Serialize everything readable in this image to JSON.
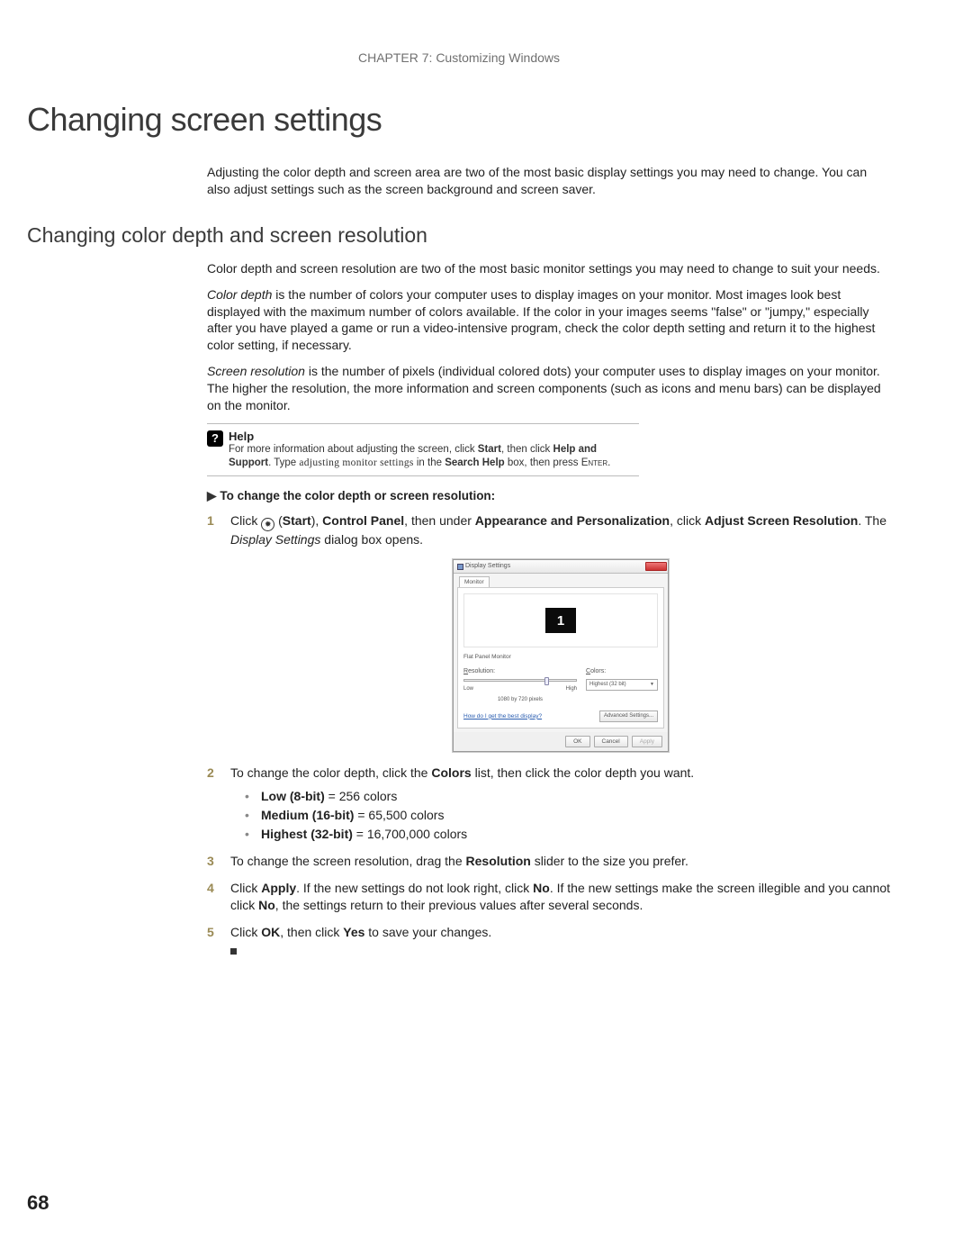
{
  "header": {
    "chapter": "CHAPTER 7: Customizing Windows"
  },
  "title": "Changing screen settings",
  "intro": "Adjusting the color depth and screen area are two of the most basic display settings you may need to change. You can also adjust settings such as the screen background and screen saver.",
  "subtitle": "Changing color depth and screen resolution",
  "para1": "Color depth and screen resolution are two of the most basic monitor settings you may need to change to suit your needs.",
  "para2_lead": "Color depth",
  "para2_rest": " is the number of colors your computer uses to display images on your monitor. Most images look best displayed with the maximum number of colors available. If the color in your images seems \"false\" or \"jumpy,\" especially after you have played a game or run a video-intensive program, check the color depth setting and return it to the highest color setting, if necessary.",
  "para3_lead": "Screen resolution",
  "para3_rest": " is the number of pixels (individual colored dots) your computer uses to display images on your monitor. The higher the resolution, the more information and screen components (such as icons and menu bars) can be displayed on the monitor.",
  "help": {
    "title": "Help",
    "line1_a": "For more information about adjusting the screen, click ",
    "line1_b": "Start",
    "line1_c": ", then click ",
    "line1_d": "Help and Support",
    "line1_e": ". Type ",
    "line1_f": "adjusting monitor settings",
    "line1_g": " in the ",
    "line1_h": "Search Help",
    "line1_i": " box, then press ",
    "line1_j": "Enter",
    "line1_k": "."
  },
  "procedure_title": "To change the color depth or screen resolution:",
  "steps": {
    "s1_a": "Click ",
    "s1_b": " (",
    "s1_c": "Start",
    "s1_d": "), ",
    "s1_e": "Control Panel",
    "s1_f": ", then under ",
    "s1_g": "Appearance and Personalization",
    "s1_h": ", click ",
    "s1_i": "Adjust Screen Resolution",
    "s1_j": ". The ",
    "s1_k": "Display Settings",
    "s1_l": " dialog box opens.",
    "s2_a": "To change the color depth, click the ",
    "s2_b": "Colors",
    "s2_c": " list, then click the color depth you want.",
    "bullets": {
      "b1_a": "Low (8-bit)",
      "b1_b": " = 256 colors",
      "b2_a": "Medium (16-bit)",
      "b2_b": " = 65,500 colors",
      "b3_a": "Highest (32-bit)",
      "b3_b": " = 16,700,000 colors"
    },
    "s3_a": "To change the screen resolution, drag the ",
    "s3_b": "Resolution",
    "s3_c": " slider to the size you prefer.",
    "s4_a": "Click ",
    "s4_b": "Apply",
    "s4_c": ". If the new settings do not look right, click ",
    "s4_d": "No",
    "s4_e": ". If the new settings make the screen illegible and you cannot click ",
    "s4_f": "No",
    "s4_g": ", the settings return to their previous values after several seconds.",
    "s5_a": "Click ",
    "s5_b": "OK",
    "s5_c": ", then click ",
    "s5_d": "Yes",
    "s5_e": " to save your changes."
  },
  "dialog": {
    "title": "Display Settings",
    "tab": "Monitor",
    "monitor_num": "1",
    "monitor_name": "Flat Panel Monitor",
    "res_label": "Resolution:",
    "res_low": "Low",
    "res_high": "High",
    "res_value": "1080 by 720 pixels",
    "colors_label": "Colors:",
    "colors_value": "Highest (32 bit)",
    "help_link": "How do I get the best display?",
    "adv_btn": "Advanced Settings...",
    "ok": "OK",
    "cancel": "Cancel",
    "apply": "Apply"
  },
  "page_number": "68"
}
